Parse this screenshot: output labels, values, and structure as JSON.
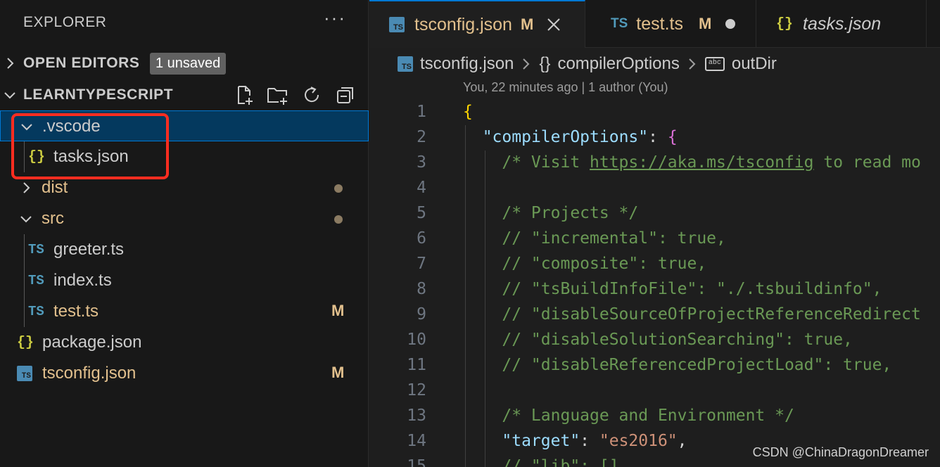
{
  "sidebar": {
    "title": "EXPLORER",
    "more_icon": "ellipsis-icon",
    "open_editors": {
      "label": "OPEN EDITORS",
      "badge": "1 unsaved"
    },
    "workspace": {
      "label": "LEARNTYPESCRIPT",
      "actions": [
        "new-file-icon",
        "new-folder-icon",
        "refresh-icon",
        "collapse-all-icon"
      ]
    },
    "tree": [
      {
        "name": ".vscode",
        "kind": "folder",
        "expanded": true,
        "selected": true
      },
      {
        "name": "tasks.json",
        "kind": "json"
      },
      {
        "name": "dist",
        "kind": "folder",
        "expanded": false,
        "dot": true
      },
      {
        "name": "src",
        "kind": "folder",
        "expanded": true,
        "dot": true
      },
      {
        "name": "greeter.ts",
        "kind": "ts"
      },
      {
        "name": "index.ts",
        "kind": "ts"
      },
      {
        "name": "test.ts",
        "kind": "ts",
        "status": "M"
      },
      {
        "name": "package.json",
        "kind": "json"
      },
      {
        "name": "tsconfig.json",
        "kind": "tsconfig",
        "status": "M"
      }
    ],
    "icons": {
      "ts": "TS",
      "json": "{}",
      "tsconfig": "TS"
    }
  },
  "tabs": [
    {
      "label": "tsconfig.json",
      "status": "M",
      "active": true,
      "icon": "TS"
    },
    {
      "label": "test.ts",
      "status": "M",
      "dirty": true,
      "icon": "TS"
    },
    {
      "label": "tasks.json",
      "italic": true,
      "icon": "{}"
    }
  ],
  "breadcrumb": {
    "file": "tsconfig.json",
    "object_icon": "{}",
    "object": "compilerOptions",
    "property_icon": "abc",
    "property": "outDir"
  },
  "blame": "You, 22 minutes ago | 1 author (You)",
  "code_lines": [
    {
      "n": "1",
      "parts": [
        [
          "c-brace",
          "{"
        ]
      ]
    },
    {
      "n": "2",
      "parts": [
        [
          "c-punct",
          "  "
        ],
        [
          "c-key",
          "\"compilerOptions\""
        ],
        [
          "c-punct",
          ": "
        ],
        [
          "c-brace2",
          "{"
        ]
      ]
    },
    {
      "n": "3",
      "parts": [
        [
          "c-punct",
          "    "
        ],
        [
          "c-comment",
          "/* Visit "
        ],
        [
          "c-link",
          "https://aka.ms/tsconfig"
        ],
        [
          "c-comment",
          " to read mo"
        ]
      ]
    },
    {
      "n": "4",
      "parts": []
    },
    {
      "n": "5",
      "parts": [
        [
          "c-punct",
          "    "
        ],
        [
          "c-comment",
          "/* Projects */"
        ]
      ]
    },
    {
      "n": "6",
      "parts": [
        [
          "c-punct",
          "    "
        ],
        [
          "c-comment",
          "// \"incremental\": true,"
        ]
      ]
    },
    {
      "n": "7",
      "parts": [
        [
          "c-punct",
          "    "
        ],
        [
          "c-comment",
          "// \"composite\": true,"
        ]
      ]
    },
    {
      "n": "8",
      "parts": [
        [
          "c-punct",
          "    "
        ],
        [
          "c-comment",
          "// \"tsBuildInfoFile\": \"./.tsbuildinfo\","
        ]
      ]
    },
    {
      "n": "9",
      "parts": [
        [
          "c-punct",
          "    "
        ],
        [
          "c-comment",
          "// \"disableSourceOfProjectReferenceRedirect"
        ]
      ]
    },
    {
      "n": "10",
      "parts": [
        [
          "c-punct",
          "    "
        ],
        [
          "c-comment",
          "// \"disableSolutionSearching\": true,"
        ]
      ]
    },
    {
      "n": "11",
      "parts": [
        [
          "c-punct",
          "    "
        ],
        [
          "c-comment",
          "// \"disableReferencedProjectLoad\": true,"
        ]
      ]
    },
    {
      "n": "12",
      "parts": []
    },
    {
      "n": "13",
      "parts": [
        [
          "c-punct",
          "    "
        ],
        [
          "c-comment",
          "/* Language and Environment */"
        ]
      ]
    },
    {
      "n": "14",
      "parts": [
        [
          "c-punct",
          "    "
        ],
        [
          "c-key",
          "\"target\""
        ],
        [
          "c-punct",
          ": "
        ],
        [
          "c-str",
          "\"es2016\""
        ],
        [
          "c-punct",
          ","
        ]
      ]
    },
    {
      "n": "15",
      "parts": [
        [
          "c-punct",
          "    "
        ],
        [
          "c-comment",
          "// \"lib\": [],"
        ]
      ]
    }
  ],
  "watermark": "CSDN @ChinaDragonDreamer",
  "colors": {
    "modified": "#e2c08d",
    "selection": "#04395e",
    "focus_border": "#0078d4",
    "annotation_box": "#ff2d20"
  }
}
